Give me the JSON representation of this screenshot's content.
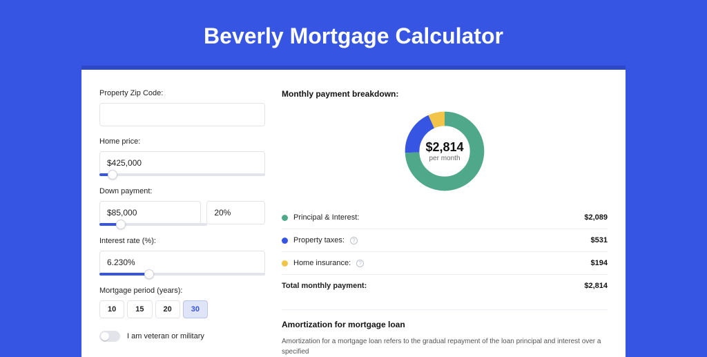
{
  "title": "Beverly Mortgage Calculator",
  "form": {
    "zip_label": "Property Zip Code:",
    "zip_value": "",
    "home_price_label": "Home price:",
    "home_price_value": "$425,000",
    "home_price_slider_pct": 8,
    "down_payment_label": "Down payment:",
    "down_payment_value": "$85,000",
    "down_payment_pct_value": "20%",
    "down_payment_slider_pct": 20,
    "interest_label": "Interest rate (%):",
    "interest_value": "6.230%",
    "interest_slider_pct": 30,
    "period_label": "Mortgage period (years):",
    "periods": [
      "10",
      "15",
      "20",
      "30"
    ],
    "period_active": "30",
    "veteran_label": "I am veteran or military"
  },
  "breakdown": {
    "heading": "Monthly payment breakdown:",
    "donut_value": "$2,814",
    "donut_sub": "per month",
    "items": [
      {
        "label": "Principal & Interest:",
        "value": "$2,089",
        "color": "#4fa88a",
        "help": false
      },
      {
        "label": "Property taxes:",
        "value": "$531",
        "color": "#3555e2",
        "help": true
      },
      {
        "label": "Home insurance:",
        "value": "$194",
        "color": "#f2c548",
        "help": true
      }
    ],
    "total_label": "Total monthly payment:",
    "total_value": "$2,814"
  },
  "amort": {
    "title": "Amortization for mortgage loan",
    "text": "Amortization for a mortgage loan refers to the gradual repayment of the loan principal and interest over a specified"
  },
  "chart_data": {
    "type": "pie",
    "title": "Monthly payment breakdown",
    "series": [
      {
        "name": "Principal & Interest",
        "value": 2089,
        "color": "#4fa88a"
      },
      {
        "name": "Property taxes",
        "value": 531,
        "color": "#3555e2"
      },
      {
        "name": "Home insurance",
        "value": 194,
        "color": "#f2c548"
      }
    ],
    "total": 2814,
    "center_label": "$2,814 per month"
  }
}
